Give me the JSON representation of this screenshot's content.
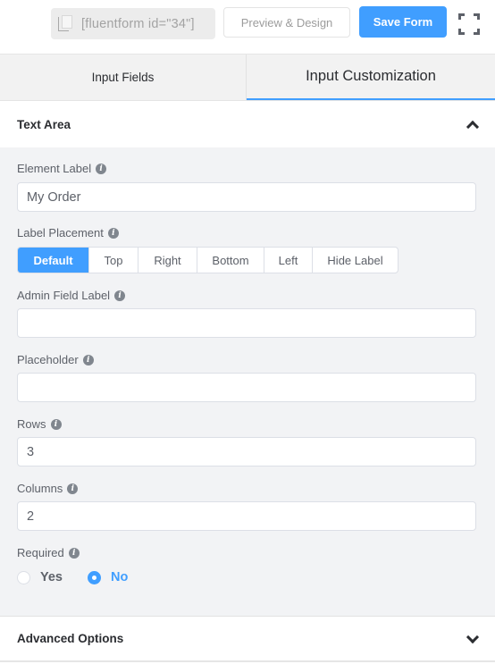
{
  "toolbar": {
    "shortcode": "[fluentform id=\"34\"]",
    "shortcode_icon": "copy-icon",
    "preview_label": "Preview & Design",
    "save_label": "Save Form",
    "fullscreen_icon": "fullscreen-icon"
  },
  "tabs": [
    {
      "label": "Input Fields",
      "active": false
    },
    {
      "label": "Input Customization",
      "active": true
    }
  ],
  "section": {
    "title": "Text Area",
    "toggle_icon": "chevron-up-icon"
  },
  "fields": {
    "element_label": {
      "label": "Element Label",
      "value": "My Order"
    },
    "label_placement": {
      "label": "Label Placement",
      "options": [
        "Default",
        "Top",
        "Right",
        "Bottom",
        "Left",
        "Hide Label"
      ],
      "selected": "Default"
    },
    "admin_field_label": {
      "label": "Admin Field Label",
      "value": ""
    },
    "placeholder": {
      "label": "Placeholder",
      "value": ""
    },
    "rows": {
      "label": "Rows",
      "value": "3"
    },
    "columns": {
      "label": "Columns",
      "value": "2"
    },
    "required": {
      "label": "Required",
      "options": [
        "Yes",
        "No"
      ],
      "selected": "No"
    }
  },
  "advanced": {
    "title": "Advanced Options",
    "toggle_icon": "chevron-down-icon"
  },
  "colors": {
    "accent": "#409eff",
    "panel_bg": "#f2f3f5",
    "label_text": "#5d6169"
  }
}
